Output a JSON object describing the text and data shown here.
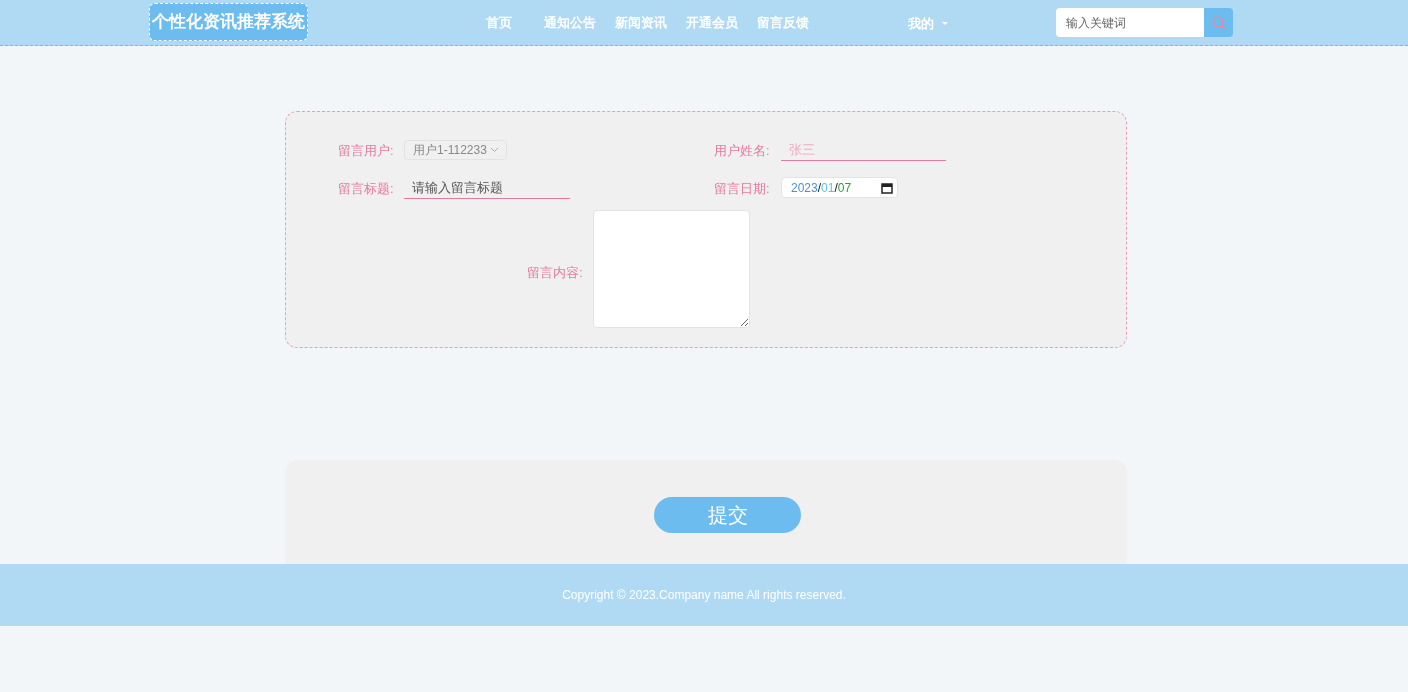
{
  "header": {
    "logo": "个性化资讯推荐系统",
    "nav": [
      {
        "label": "首页",
        "selected": false
      },
      {
        "label": "通知公告",
        "selected": false
      },
      {
        "label": "新闻资讯",
        "selected": false
      },
      {
        "label": "开通会员",
        "selected": false
      },
      {
        "label": "留言反馈",
        "selected": false
      }
    ],
    "user_menu": "我的",
    "search": {
      "placeholder": "输入关键词"
    }
  },
  "form": {
    "user": {
      "label": "留言用户:",
      "value": "用户1-112233",
      "disabled": true
    },
    "name": {
      "label": "用户姓名:",
      "value": "张三"
    },
    "title": {
      "label": "留言标题:",
      "placeholder": "请输入留言标题"
    },
    "date": {
      "label": "留言日期:",
      "parts": [
        {
          "text": "2023",
          "color": "#4a90d9"
        },
        {
          "text": "/"
        },
        {
          "text": "01",
          "color": "#5bc0eb"
        },
        {
          "text": "/"
        },
        {
          "text": "07",
          "color": "#2e9e3e"
        }
      ]
    },
    "content": {
      "label": "留言内容:"
    }
  },
  "submit": "提交",
  "footer": "Copyright © 2023.Company name All rights reserved."
}
